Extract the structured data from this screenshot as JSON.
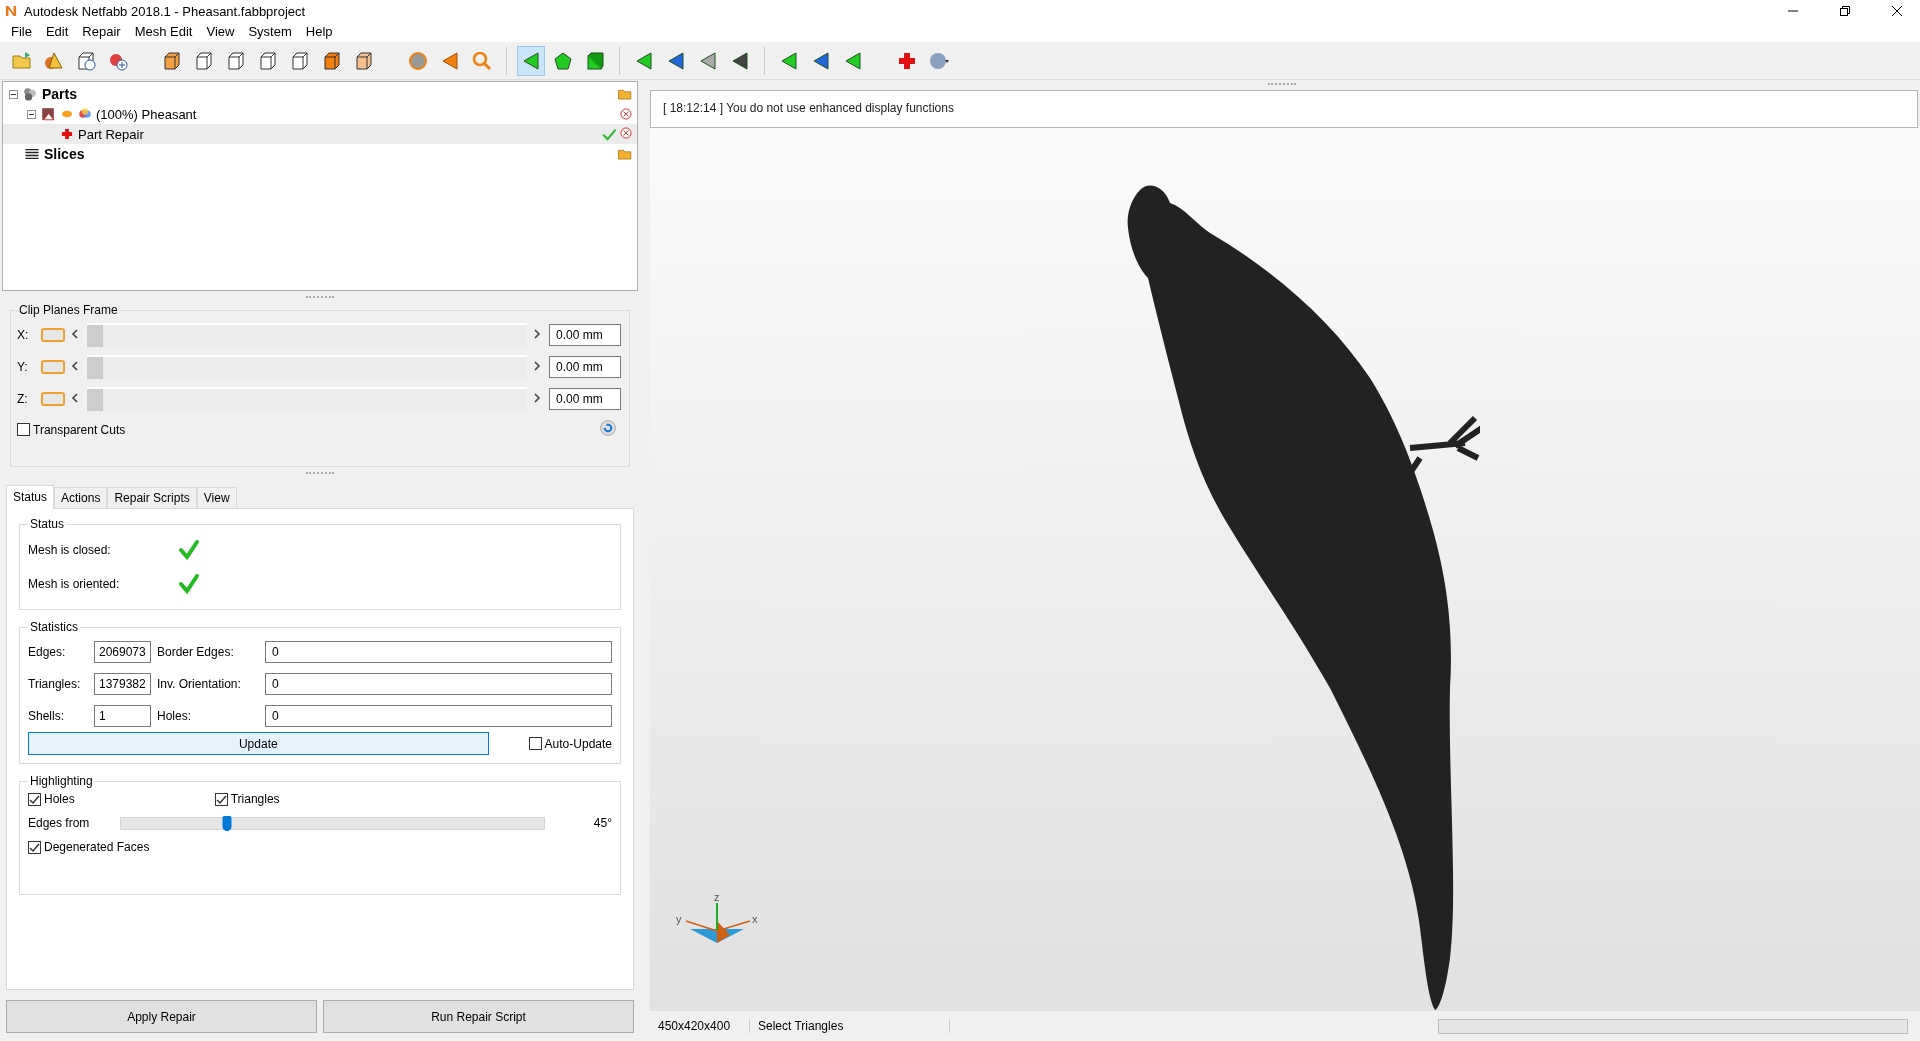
{
  "window": {
    "title": "Autodesk Netfabb 2018.1 - Pheasant.fabbproject"
  },
  "menu": [
    "File",
    "Edit",
    "Repair",
    "Mesh Edit",
    "View",
    "System",
    "Help"
  ],
  "tree": [
    {
      "label": "Parts",
      "kind": "group",
      "selected": false,
      "expanded": true,
      "children": [
        {
          "label": "(100%) Pheasant",
          "kind": "part",
          "selected": false,
          "expanded": true,
          "children": [
            {
              "label": "Part Repair",
              "kind": "repair",
              "selected": true
            }
          ]
        }
      ]
    },
    {
      "label": "Slices",
      "kind": "slices",
      "selected": false
    }
  ],
  "clip_planes": {
    "title": "Clip Planes Frame",
    "axes": [
      {
        "label": "X:",
        "value": "0.00 mm",
        "level": 0
      },
      {
        "label": "Y:",
        "value": "0.00 mm",
        "level": 0
      },
      {
        "label": "Z:",
        "value": "0.00 mm",
        "level": 0
      }
    ],
    "transparent_cuts": {
      "label": "Transparent Cuts",
      "checked": false
    }
  },
  "tabs": [
    {
      "label": "Status",
      "selected": true
    },
    {
      "label": "Actions",
      "selected": false
    },
    {
      "label": "Repair Scripts",
      "selected": false
    },
    {
      "label": "View",
      "selected": false
    }
  ],
  "status_group": {
    "title": "Status",
    "items": [
      {
        "label": "Mesh is closed:",
        "ok": true
      },
      {
        "label": "Mesh is oriented:",
        "ok": true
      }
    ]
  },
  "statistics": {
    "title": "Statistics",
    "rows": [
      {
        "label": "Edges:",
        "value": "2069073",
        "label2": "Border Edges:",
        "value2": "0"
      },
      {
        "label": "Triangles:",
        "value": "1379382",
        "label2": "Inv. Orientation:",
        "value2": "0"
      },
      {
        "label": "Shells:",
        "value": "1",
        "label2": "Holes:",
        "value2": "0"
      }
    ],
    "update_button": "Update",
    "auto_update": {
      "label": "Auto-Update",
      "checked": false
    }
  },
  "highlighting": {
    "title": "Highlighting",
    "holes": {
      "label": "Holes",
      "checked": true
    },
    "triangles": {
      "label": "Triangles",
      "checked": true
    },
    "edges_from": {
      "label": "Edges from",
      "level": 0.25,
      "reading": "45°"
    },
    "degenerated": {
      "label": "Degenerated Faces",
      "checked": true
    }
  },
  "buttons": [
    "Apply Repair",
    "Run Repair Script"
  ],
  "log": [
    "[ 18:12:14 ] You do not use enhanced display functions"
  ],
  "axes": {
    "z": "z",
    "y": "y",
    "x": "x"
  },
  "status_bar": {
    "dimensions": "450x420x400",
    "mode": "Select Triangles",
    "progress": {
      "level": 0
    }
  }
}
